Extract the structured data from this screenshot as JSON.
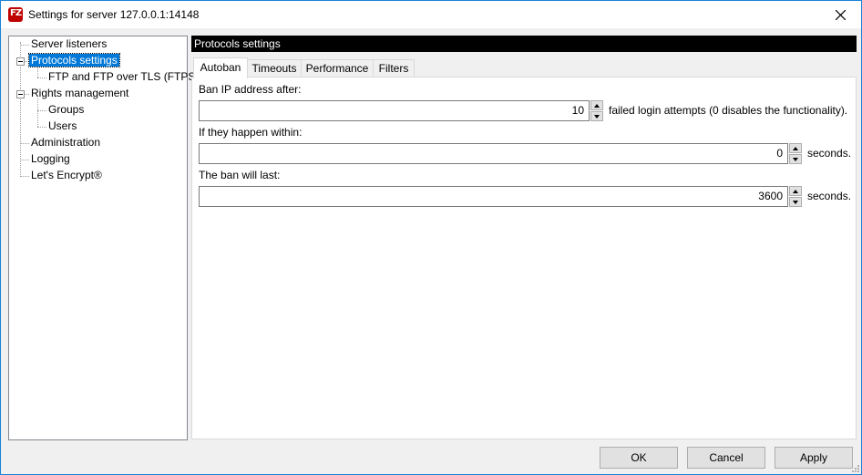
{
  "window": {
    "title": "Settings for server 127.0.0.1:14148",
    "app_icon_text": "FZ"
  },
  "tree": {
    "items": [
      {
        "label": "Server listeners"
      },
      {
        "label": "Protocols settings",
        "selected": true
      },
      {
        "label": "FTP and FTP over TLS (FTPS)"
      },
      {
        "label": "Rights management"
      },
      {
        "label": "Groups"
      },
      {
        "label": "Users"
      },
      {
        "label": "Administration"
      },
      {
        "label": "Logging"
      },
      {
        "label": "Let's Encrypt®"
      }
    ]
  },
  "panel": {
    "header": "Protocols settings",
    "tabs": [
      {
        "label": "Autoban",
        "active": true
      },
      {
        "label": "Timeouts"
      },
      {
        "label": "Performance"
      },
      {
        "label": "Filters"
      }
    ],
    "fields": [
      {
        "label": "Ban IP address after:",
        "value": "10",
        "suffix": "failed login attempts (0 disables the functionality)."
      },
      {
        "label": "If they happen within:",
        "value": "0",
        "suffix": "seconds."
      },
      {
        "label": "The ban will last:",
        "value": "3600",
        "suffix": "seconds."
      }
    ]
  },
  "buttons": {
    "ok": "OK",
    "cancel": "Cancel",
    "apply": "Apply"
  }
}
